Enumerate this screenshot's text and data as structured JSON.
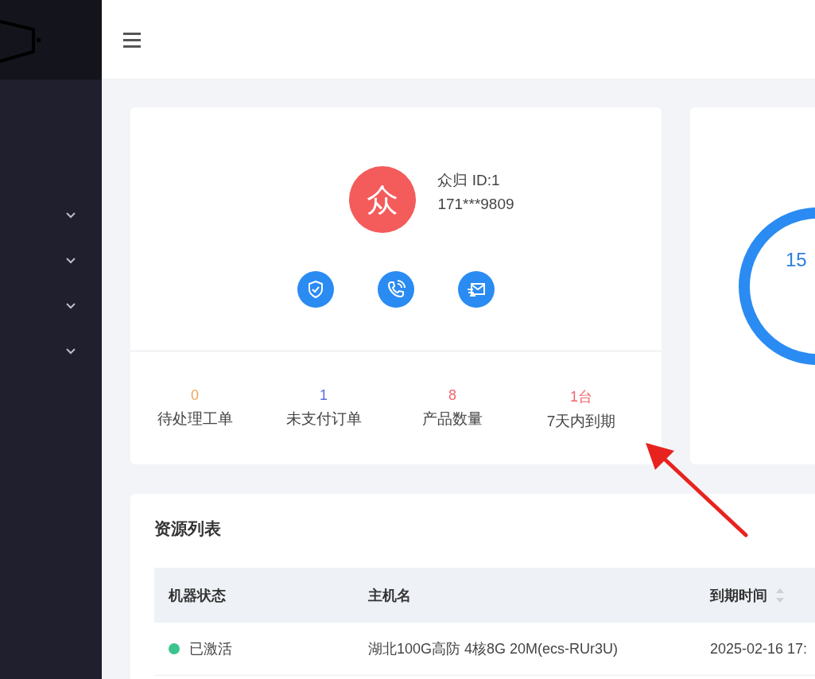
{
  "sidebar": {
    "menu_groups": [
      {
        "expanded": false
      },
      {
        "expanded": false
      },
      {
        "expanded": false
      },
      {
        "expanded": false
      }
    ]
  },
  "profile": {
    "avatar_text": "众",
    "name": "众归 ID:1",
    "phone": "171***9809",
    "stats": [
      {
        "value": "0",
        "label": "待处理工单",
        "color": "#f0a35a"
      },
      {
        "value": "1",
        "label": "未支付订单",
        "color": "#5b6ee0"
      },
      {
        "value": "8",
        "label": "产品数量",
        "color": "#f0656a"
      },
      {
        "value": "1台",
        "label": "7天内到期",
        "color": "#f0656a"
      }
    ]
  },
  "summary": {
    "ring_value": "15"
  },
  "resources": {
    "title": "资源列表",
    "columns": [
      "机器状态",
      "主机名",
      "到期时间"
    ],
    "rows": [
      {
        "status": "已激活",
        "color": "#3cc48f",
        "hostname": "湖北100G高防 4核8G 20M(ecs-RUr3U)",
        "expiry": "2025-02-16 17:"
      }
    ]
  }
}
